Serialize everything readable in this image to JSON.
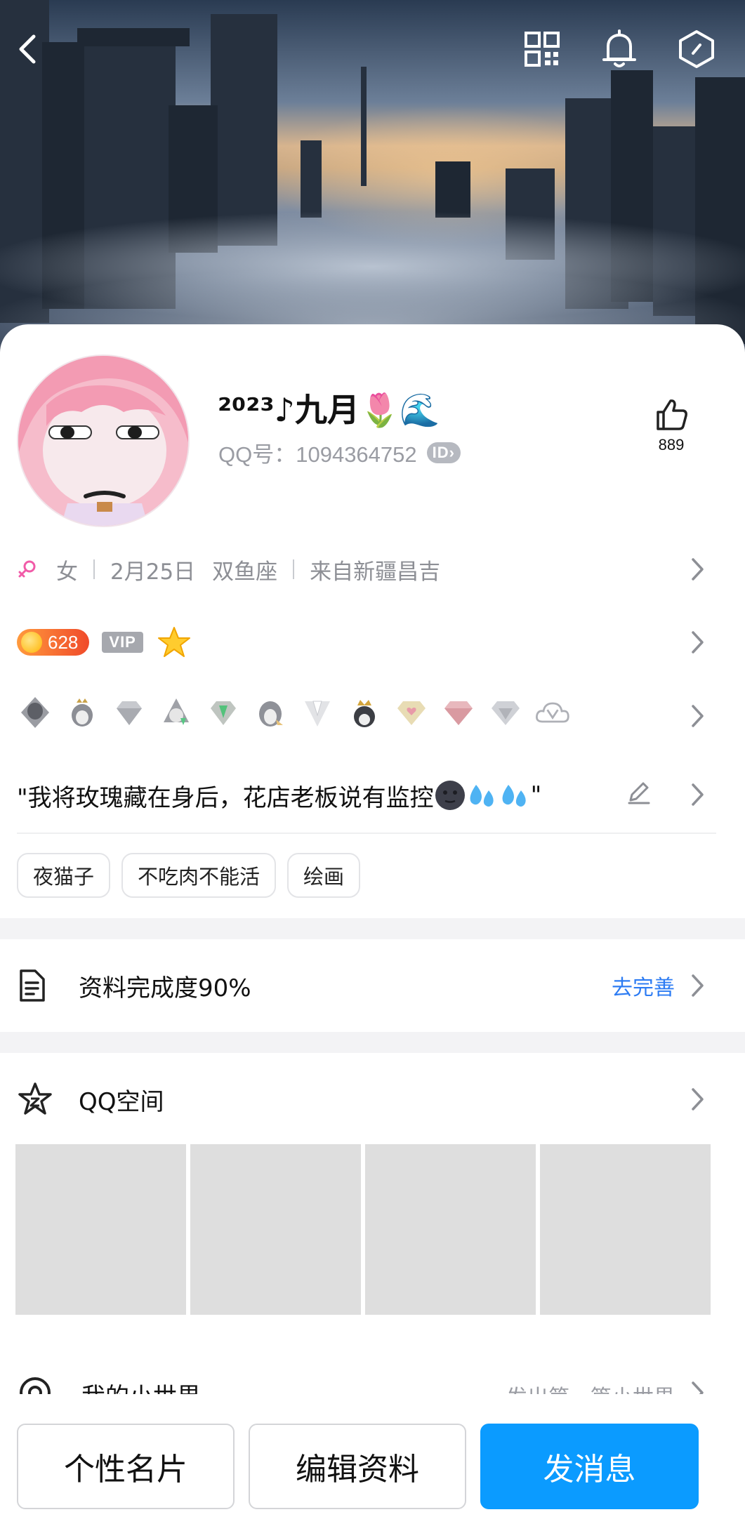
{
  "profile": {
    "nickname": "²⁰²³♪九月🌷🌊",
    "qq_number": "QQ号：1094364752",
    "id_badge": "ID",
    "likes": "889"
  },
  "info": {
    "gender": "女",
    "birthday": "2月25日",
    "zodiac": "双鱼座",
    "location": "来自新疆昌吉"
  },
  "levels": {
    "level_value": "628",
    "vip_label": "VIP"
  },
  "medals": [
    "penguin-armor",
    "penguin-crown",
    "diamond",
    "penguin-gem",
    "green-diamond",
    "penguin-wing",
    "tuxedo",
    "penguin-king",
    "gold-heart-diamond",
    "pink-diamond",
    "silver-diamond",
    "vip-cloud"
  ],
  "signature": {
    "text_before": "\"我将玫瑰藏在身后，花店老板说有监控",
    "text_after": "\""
  },
  "tags": [
    "夜猫子",
    "不吃肉不能活",
    "绘画"
  ],
  "completion": {
    "label": "资料完成度90%",
    "action": "去完善"
  },
  "qzone": {
    "label": "QQ空间"
  },
  "world": {
    "label": "我的小世界",
    "action": "发出第一篇小世界"
  },
  "bottom": {
    "card_button": "个性名片",
    "edit_button": "编辑资料",
    "message_button": "发消息"
  },
  "colors": {
    "primary": "#0b9bff",
    "link": "#2d7cf3",
    "level_badge": "#f04a2a"
  }
}
